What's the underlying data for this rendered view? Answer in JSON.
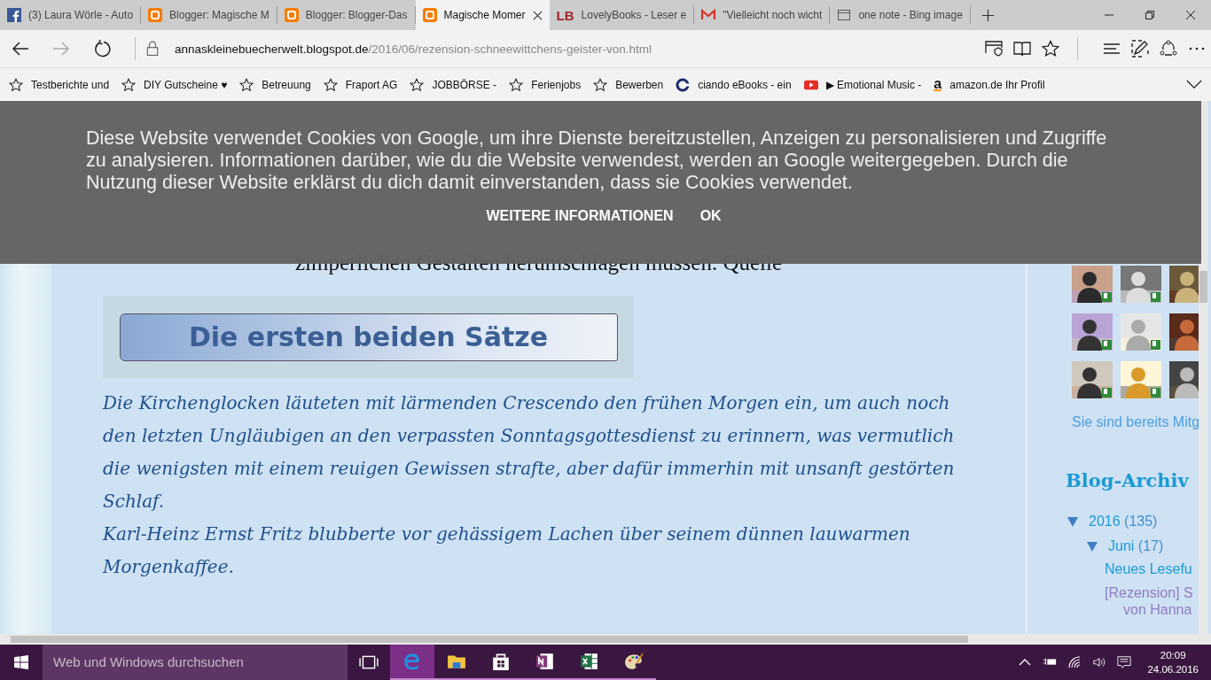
{
  "tabs": [
    {
      "label": "(3) Laura Wörle - Auto",
      "kind": "facebook",
      "selected": false
    },
    {
      "label": "Blogger: Magische M",
      "kind": "blogger",
      "selected": false
    },
    {
      "label": "Blogger: Blogger-Das",
      "kind": "blogger",
      "selected": false
    },
    {
      "label": "Magische Momer",
      "kind": "blogger",
      "selected": true
    },
    {
      "label": "LovelyBooks - Leser e",
      "kind": "lovelybooks",
      "icon_text": "LB",
      "selected": false
    },
    {
      "label": "\"Vielleicht noch wicht",
      "kind": "gmail",
      "selected": false
    },
    {
      "label": "one note - Bing image",
      "kind": "page",
      "selected": false
    }
  ],
  "address": {
    "host": "annaskleinebuecherwelt.blogspot.de",
    "path": "/2016/06/rezension-schneewittchens-geister-von.html"
  },
  "favorites": [
    {
      "label": "Testberichte und",
      "kind": "star"
    },
    {
      "label": "DIY Gutscheine ♥",
      "kind": "star"
    },
    {
      "label": "Betreuung",
      "kind": "star"
    },
    {
      "label": "Fraport AG",
      "kind": "star"
    },
    {
      "label": "JOBBÖRSE -",
      "kind": "star"
    },
    {
      "label": "Ferienjobs",
      "kind": "star"
    },
    {
      "label": "Bewerben",
      "kind": "star"
    },
    {
      "label": "ciando eBooks - ein",
      "kind": "ciando"
    },
    {
      "label": "▶ Emotional Music -",
      "kind": "youtube"
    },
    {
      "label": "amazon.de Ihr Profil",
      "kind": "amazon",
      "icon_text": "a"
    }
  ],
  "cookie_banner": {
    "text": "Diese Website verwendet Cookies von Google, um ihre Dienste bereitzustellen, Anzeigen zu personalisieren und Zugriffe zu analysieren. Informationen darüber, wie du die Website verwendest, werden an Google weitergegeben. Durch die Nutzung dieser Website erklärst du dich damit einverstanden, dass sie Cookies verwendet.",
    "buttons": [
      "WEITERE INFORMATIONEN",
      "OK"
    ]
  },
  "article": {
    "partial_line": "zimperlichen Gestalten herumschlagen müssen. Quelle",
    "banner_title": "Die ersten beiden Sätze",
    "paragraphs": [
      "Die Kirchenglocken läuteten mit lärmenden Crescendo den frühen Morgen ein, um auch noch den letzten Ungläubigen an den verpassten Sonntagsgottesdienst zu erinnern, was vermutlich die wenigsten mit einem reuigen Gewissen strafte, aber dafür immerhin mit unsanft gestörten Schlaf.",
      "Karl-Heinz Ernst Fritz blubberte vor gehässigem Lachen über seinem dünnen lauwarmen Morgenkaffee."
    ]
  },
  "sidebar": {
    "member_link": "Sie sind bereits Mitg",
    "archive_title": "Blog-Archiv",
    "archive": [
      {
        "label": "2016",
        "count": "(135)",
        "expanded": true,
        "children": [
          {
            "label": "Juni",
            "count": "(17)",
            "expanded": true,
            "posts": [
              {
                "lines": [
                  "Neues Lesefu"
                ],
                "visited": false
              },
              {
                "lines": [
                  "[Rezension] S",
                  "von Hanna"
                ],
                "visited": true
              }
            ]
          }
        ]
      }
    ]
  },
  "taskbar": {
    "search_placeholder": "Web und Windows durchsuchen",
    "time": "20:09",
    "date": "24.06.2016"
  }
}
